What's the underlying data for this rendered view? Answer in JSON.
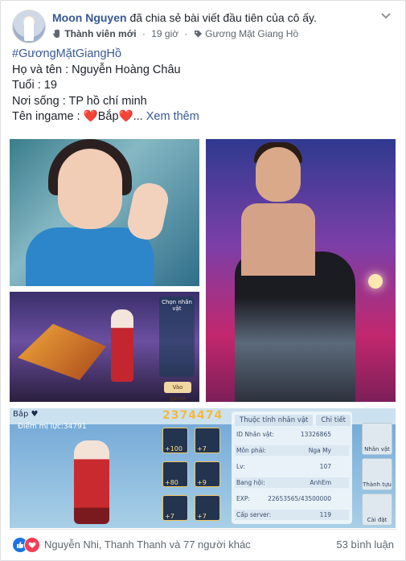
{
  "post": {
    "author": "Moon Nguyen",
    "action": "đã chia sẻ bài viết đầu tiên của cô ấy.",
    "badge": "Thành viên mới",
    "time": "19 giờ",
    "group": "Gương Mặt Giang Hồ",
    "more_icon": "chevron-down-icon"
  },
  "content": {
    "hashtag": "#GươngMặtGiangHồ",
    "line_name": "Họ và tên : Nguyễn Hoàng Châu",
    "line_age": "Tuổi : 19",
    "line_home": "Nơi sống : TP hồ chí minh",
    "ingame_prefix": "Tên ingame : ",
    "heart": "❤️",
    "ingame_name": "Bắp",
    "ellipsis": "...",
    "see_more": "Xem thêm"
  },
  "game_ui": {
    "hud_left": "Bắp ♥",
    "score": "2374474",
    "power": "Điểm mị lực:34791",
    "tabs": [
      "Thuộc tính nhân vật",
      "Chi tiết"
    ],
    "rows": [
      {
        "k": "ID Nhân vật:",
        "v": "13326865"
      },
      {
        "k": "Môn phái:",
        "v": "Nga My"
      },
      {
        "k": "Lv:",
        "v": "107"
      },
      {
        "k": "Bang hội:",
        "v": "AnhEm"
      },
      {
        "k": "EXP:",
        "v": "22653565/43500000"
      },
      {
        "k": "Cấp server:",
        "v": "119"
      }
    ],
    "slot_values": [
      "+100",
      "+7",
      "+80",
      "+9",
      "+7",
      "+7"
    ],
    "side_buttons": [
      "Nhân vật",
      "Thành tựu",
      "Cài đặt"
    ],
    "panel_title": "Chọn nhân vật",
    "start_button": "Vào game"
  },
  "footer": {
    "reactors": "Nguyễn Nhi, Thanh Thanh và 77 người khác",
    "comments": "53 bình luận"
  }
}
